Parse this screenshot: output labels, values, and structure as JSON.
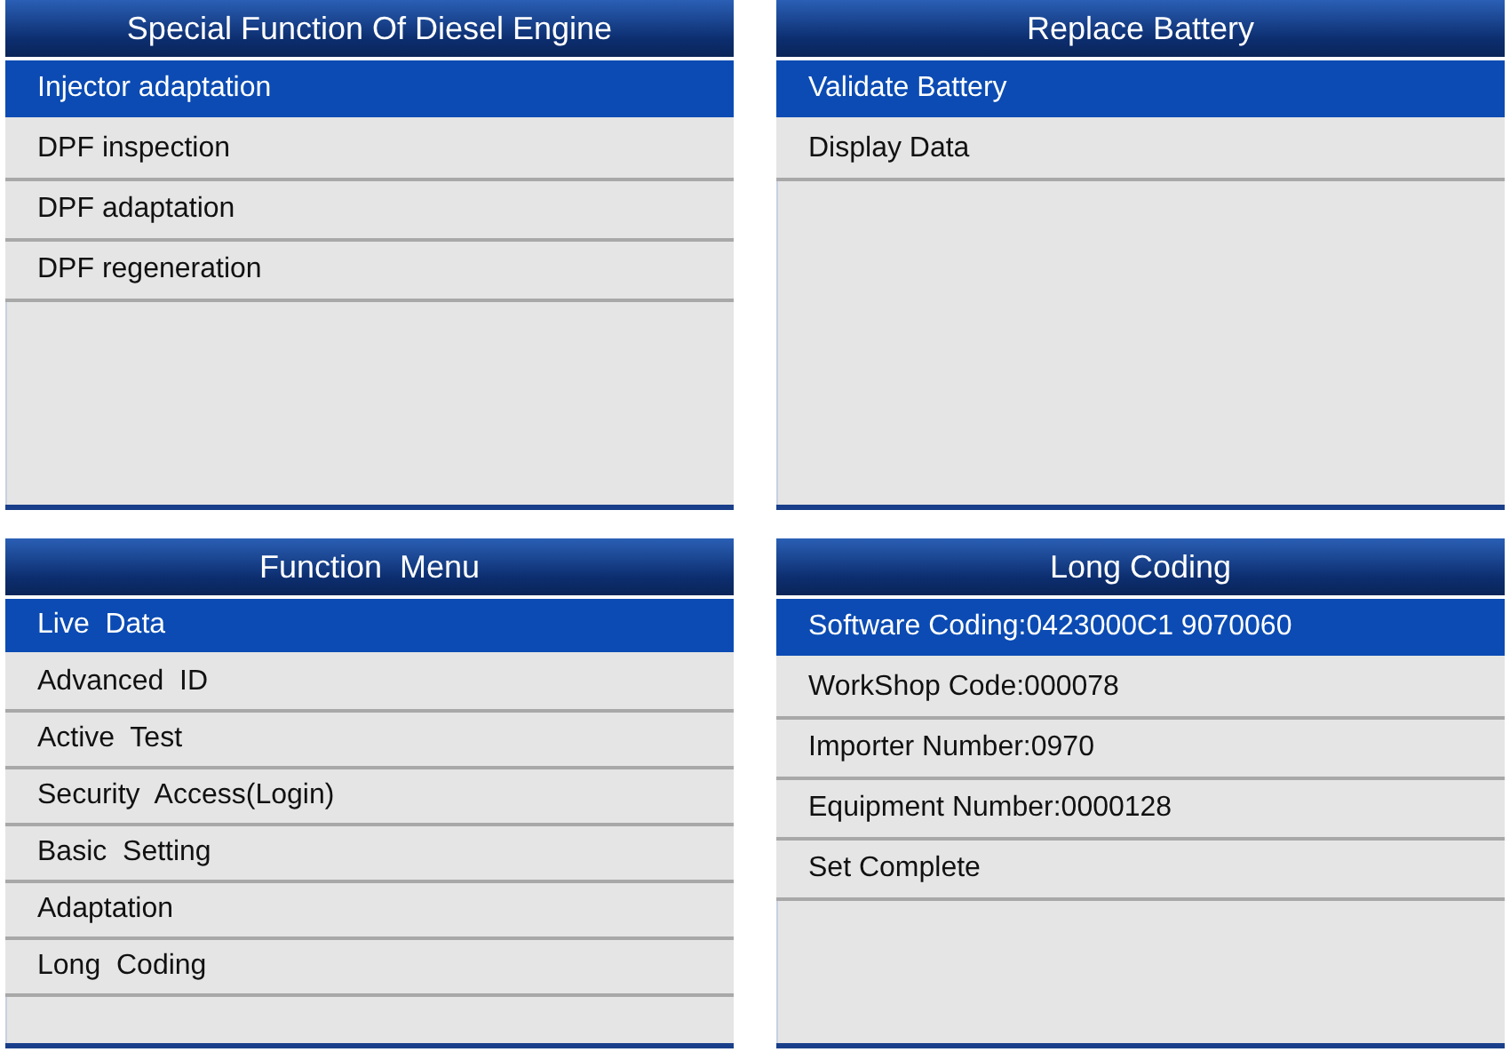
{
  "screens": [
    {
      "title": "Special Function Of Diesel Engine",
      "items": [
        {
          "label": "Injector adaptation",
          "selected": true
        },
        {
          "label": "DPF inspection",
          "selected": false
        },
        {
          "label": "DPF adaptation",
          "selected": false
        },
        {
          "label": "DPF regeneration",
          "selected": false
        }
      ]
    },
    {
      "title": "Replace Battery",
      "items": [
        {
          "label": "Validate Battery",
          "selected": true
        },
        {
          "label": "Display Data",
          "selected": false
        }
      ]
    },
    {
      "title": "Function  Menu",
      "items": [
        {
          "label": "Live  Data",
          "selected": true
        },
        {
          "label": "Advanced  ID",
          "selected": false
        },
        {
          "label": "Active  Test",
          "selected": false
        },
        {
          "label": "Security  Access(Login)",
          "selected": false
        },
        {
          "label": "Basic  Setting",
          "selected": false
        },
        {
          "label": "Adaptation",
          "selected": false
        },
        {
          "label": "Long  Coding",
          "selected": false
        }
      ]
    },
    {
      "title": "Long Coding",
      "items": [
        {
          "label": "Software Coding:0423000C1 9070060",
          "selected": true
        },
        {
          "label": "WorkShop Code:000078",
          "selected": false
        },
        {
          "label": "Importer Number:0970",
          "selected": false
        },
        {
          "label": "Equipment Number:0000128",
          "selected": false
        },
        {
          "label": "Set Complete",
          "selected": false
        }
      ]
    }
  ]
}
